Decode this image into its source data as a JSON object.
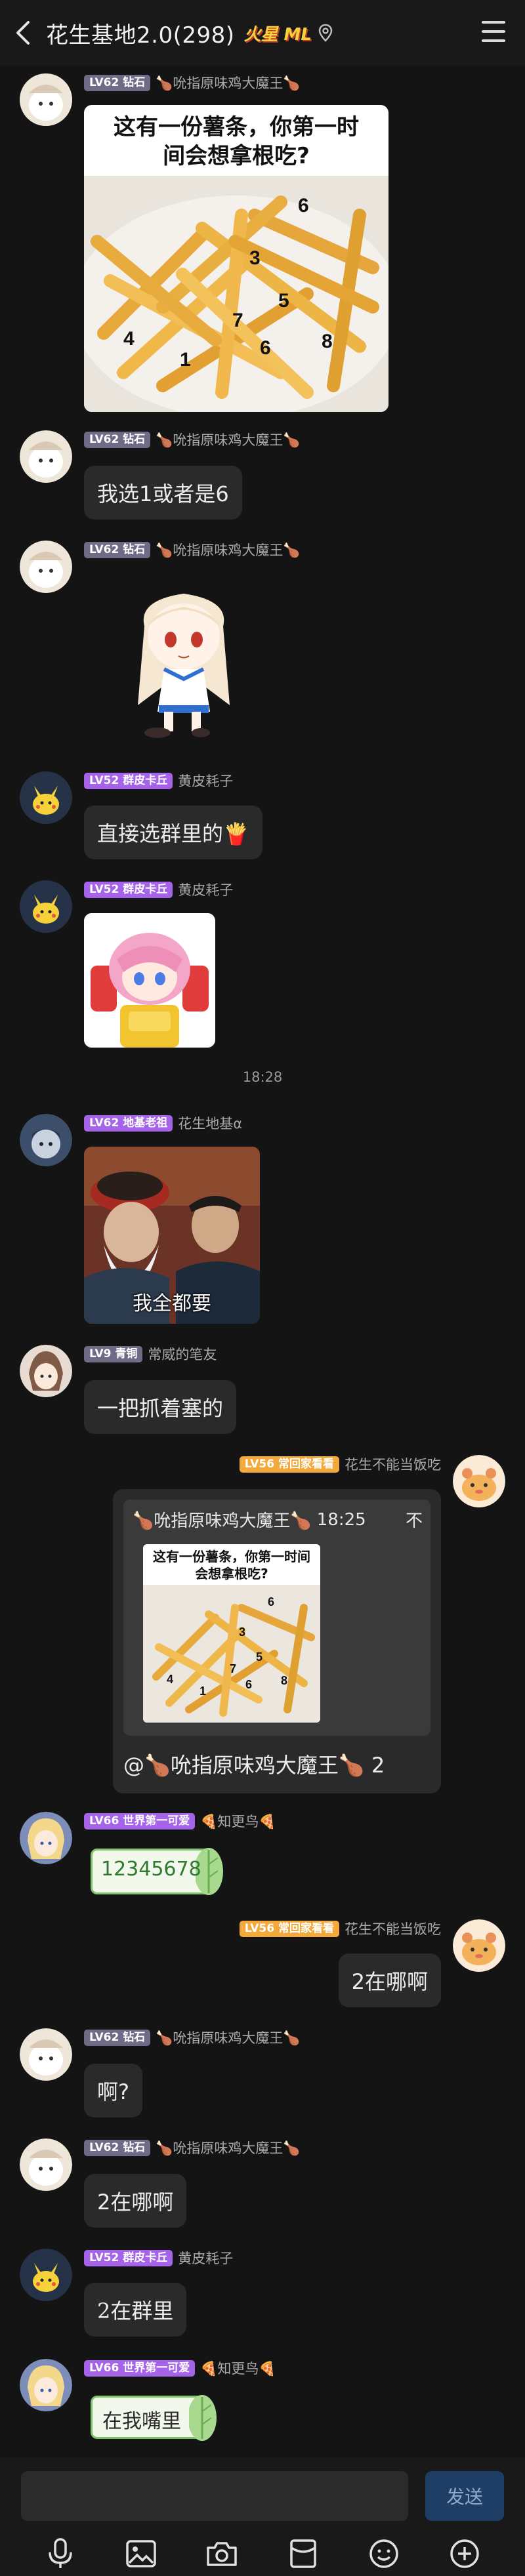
{
  "header": {
    "title": "花生基地2.0(298)",
    "badge": "火星 ML"
  },
  "messages": [
    {
      "level": "LV62 钻石",
      "name": "🍗吮指原味鸡大魔王🍗",
      "image_caption": "这有一份薯条，你第一时间会想拿根吃?",
      "fry_numbers": [
        "6",
        "3",
        "5",
        "7",
        "4",
        "1",
        "6",
        "8"
      ]
    },
    {
      "level": "LV62 钻石",
      "name": "🍗吮指原味鸡大魔王🍗",
      "text": "我选1或者是6"
    },
    {
      "level": "LV62 钻石",
      "name": "🍗吮指原味鸡大魔王🍗"
    },
    {
      "level": "LV52 群皮卡丘",
      "name": "黄皮耗子",
      "text": "直接选群里的🍟"
    },
    {
      "level": "LV52 群皮卡丘",
      "name": "黄皮耗子"
    },
    {
      "level": "LV62 地基老祖",
      "name": "花生地基α",
      "image_caption": "我全都要"
    },
    {
      "level": "LV9 青铜",
      "name": "常威的笔友",
      "text": "一把抓着塞的"
    },
    {
      "level": "LV56 常回家看看",
      "name": "花生不能当饭吃",
      "quote_author": "🍗吮指原味鸡大魔王🍗",
      "quote_time": "18:25",
      "quote_close": "不",
      "quote_caption": "这有一份薯条，你第一时间会想拿根吃?",
      "mention": "@🍗吮指原味鸡大魔王🍗",
      "text": " 2"
    },
    {
      "level": "LV66 世界第一可爱",
      "name": "🍕知更鸟🍕",
      "text": "12345678"
    },
    {
      "level": "LV56 常回家看看",
      "name": "花生不能当饭吃",
      "text": "2在哪啊"
    },
    {
      "level": "LV62 钻石",
      "name": "🍗吮指原味鸡大魔王🍗",
      "text": "啊?"
    },
    {
      "level": "LV62 钻石",
      "name": "🍗吮指原味鸡大魔王🍗",
      "text": "2在哪啊"
    },
    {
      "level": "LV52 群皮卡丘",
      "name": "黄皮耗子",
      "text": "2在群里"
    },
    {
      "level": "LV66 世界第一可爱",
      "name": "🍕知更鸟🍕",
      "text": "在我嘴里"
    }
  ],
  "timestamp": "18:28",
  "footer": {
    "input_placeholder": "",
    "send_label": "发送"
  },
  "colors": {
    "background": "#141414",
    "bubble": "#2A2A2A",
    "send_button": "#1E3E66"
  },
  "icons": [
    "back-icon",
    "location-icon",
    "menu-icon",
    "microphone-icon",
    "image-icon",
    "camera-icon",
    "red-packet-icon",
    "emoji-icon",
    "plus-icon"
  ]
}
